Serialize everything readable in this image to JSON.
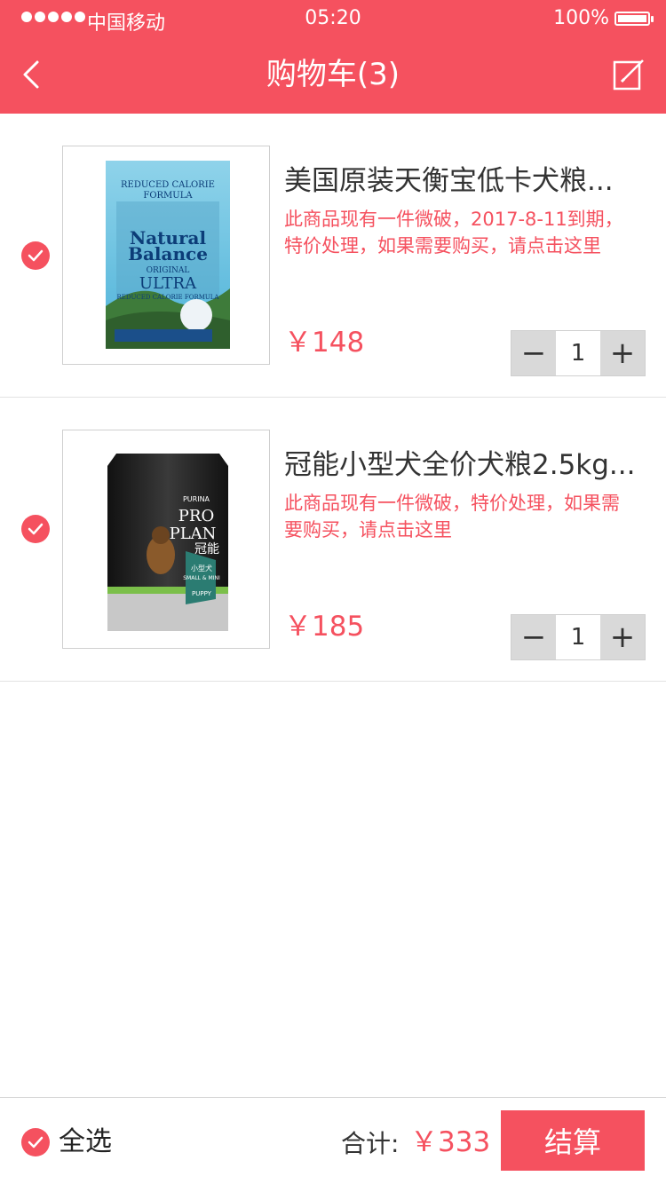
{
  "status_bar": {
    "carrier": "中国移动",
    "time": "05:20",
    "battery": "100%"
  },
  "nav": {
    "title": "购物车(3)",
    "back_icon": "chevron-left-icon",
    "edit_icon": "edit-icon"
  },
  "items": [
    {
      "title": "美国原装天衡宝低卡犬粮...",
      "note": "此商品现有一件微破，2017-8-11到期，特价处理，如果需要购买，请点击这里",
      "price": "￥148",
      "quantity": "1",
      "checked": true,
      "image_text": [
        "REDUCED CALORIE",
        "FORMULA",
        "Natural",
        "Balance",
        "ORIGINAL",
        "ULTRA",
        "REDUCED CALORIE FORMULA"
      ]
    },
    {
      "title": "冠能小型犬全价犬粮2.5kg...",
      "note": "此商品现有一件微破，特价处理，如果需要购买，请点击这里",
      "price": "￥185",
      "quantity": "1",
      "checked": true,
      "image_text": [
        "PURINA",
        "PRO",
        "PLAN",
        "冠能",
        "小型犬",
        "SMALL & MINI",
        "PUPPY"
      ]
    }
  ],
  "stepper": {
    "minus": "−",
    "plus": "+"
  },
  "footer": {
    "select_all": "全选",
    "total_label": "合计:",
    "total_value": "￥333",
    "checkout": "结算"
  },
  "colors": {
    "accent": "#f5515f",
    "divider": "#e3e3e3",
    "stepper_bg": "#d9d9d9"
  }
}
